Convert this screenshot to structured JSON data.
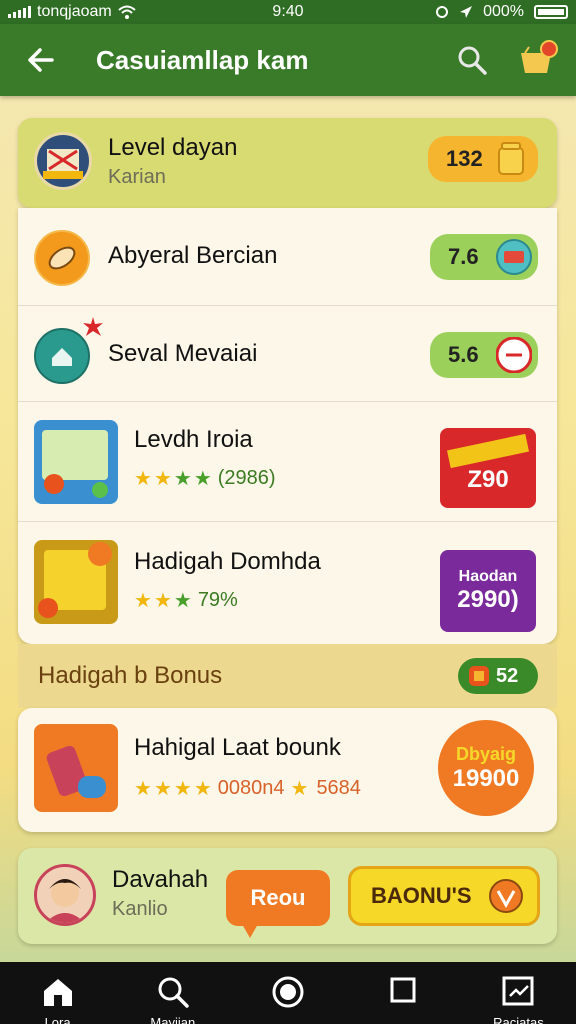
{
  "status_bar": {
    "carrier": "tonqjaoam",
    "time": "9:40",
    "battery": "000%"
  },
  "app_bar": {
    "title": "Casuiamllap kam"
  },
  "header_card": {
    "title": "Level dayan",
    "subtitle": "Karian",
    "points": "132"
  },
  "rows": [
    {
      "title": "Abyeral Bercian",
      "score": "7.6"
    },
    {
      "title": "Seval Mevaiai",
      "score": "5.6"
    },
    {
      "title": "Levdh Iroia",
      "rating_count": "(2986)",
      "promo_label": "Z90"
    },
    {
      "title": "Hadigah Domhda",
      "rating_text": "79%",
      "promo_top": "Haodan",
      "promo_value": "2990)"
    }
  ],
  "bonus_section": {
    "title": "Hadigah b Bonus",
    "badge_value": "52"
  },
  "bonus_card": {
    "title": "Hahigal Laat bounk",
    "rating_text": "0080n4",
    "rating_extra": "5684",
    "offer_top": "Dbyaig",
    "offer_value": "19900"
  },
  "user_card": {
    "name": "Davahah",
    "subtitle": "Kanlio",
    "tooltip_label": "Reou",
    "bonus_button": "BAONU'S"
  },
  "bottom_nav": {
    "items": [
      {
        "label": "Lora"
      },
      {
        "label": "Mayiian"
      },
      {
        "label": ""
      },
      {
        "label": ""
      },
      {
        "label": "Raciatas"
      }
    ]
  },
  "colors": {
    "app_bar": "#3a7b2a",
    "header_card": "#d8db72",
    "score_pill": "#9bd05a",
    "points_pill": "#f6b52e",
    "promo_red": "#d8282a",
    "promo_purple": "#7b2a9c",
    "offer_orange": "#f07a24",
    "bonus_button": "#f6d829"
  }
}
